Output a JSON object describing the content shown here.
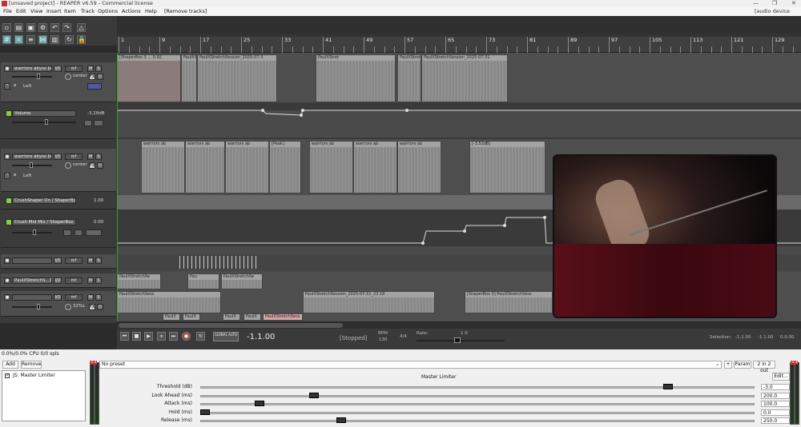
{
  "window": {
    "title": "[unsaved project] - REAPER v6.59 - Commercial license",
    "controls": [
      "—",
      "❐",
      "✕"
    ]
  },
  "menu": {
    "items": [
      "File",
      "Edit",
      "View",
      "Insert",
      "Item",
      "Track",
      "Options",
      "Actions",
      "Help",
      "[Remove tracks]"
    ],
    "right_status": "[audio device closed]"
  },
  "ruler": {
    "bars": [
      "1",
      "9",
      "17",
      "25",
      "33",
      "41",
      "49",
      "57",
      "65",
      "73",
      "81",
      "89",
      "97",
      "105",
      "113",
      "121",
      "129"
    ]
  },
  "tracks": {
    "t1": {
      "name": "warriors abyss be",
      "pan": "center",
      "fx": "FX",
      "label": "Left",
      "mute": "M",
      "solo": "S",
      "io": "I/O",
      "rec": "mf"
    },
    "t1env": {
      "name": "Volume",
      "value": "-3.28dB"
    },
    "t2": {
      "name": "warriors abyss be",
      "pan": "center",
      "fx": "FX",
      "label": "Left",
      "mute": "M",
      "solo": "S",
      "io": "I/O",
      "rec": "mf"
    },
    "t2env1": {
      "name": "CrushShaper On / ShaperBox 3",
      "value": "1.00"
    },
    "t2env2": {
      "name": "Crush Mid Mix / ShaperBox 3",
      "value": "0.00"
    },
    "t3": {
      "name": "",
      "io": "I/O",
      "rec": "mf",
      "mute": "M",
      "solo": "S"
    },
    "t4": {
      "name": "PaulXStretchS...14",
      "io": "I/O",
      "rec": "mf",
      "mute": "M",
      "solo": "S"
    },
    "t5": {
      "name": "",
      "pan": "32%L",
      "io": "I/O",
      "rec": "mf",
      "mute": "M",
      "solo": "S"
    }
  },
  "items": {
    "r1": [
      "[ShaperBox 3 ... 0.92",
      "PaulXSt",
      "PaulXStretchSession_2025-07-3",
      "PaulXStret",
      "PaulXStret",
      "PaulXStretchSession_2025-07-31"
    ],
    "r2": [
      "warriors ab",
      "warriors ab",
      "warriors ab",
      "[Peak]",
      "warriors ab",
      "warriors ab",
      "warriors ab",
      "[-3.52dB]"
    ],
    "r3": [
      "PaulXStretchSe",
      "Pau",
      "PaulXStretchSe"
    ],
    "r4": [
      "[ShaperBox 3]",
      "PaulXStretchSess",
      "PaulXStretchSession_2025-07-31_23.18",
      "PaulXS",
      "[ShaperBox 3] PaulXStretchSess"
    ],
    "r5": [
      "PaulX",
      "PaulX",
      "PaulX",
      "PaulX",
      "PaulXStretchSess"
    ]
  },
  "transport": {
    "time": "-1.1.00",
    "status": "[Stopped]",
    "bpm_label": "BPM",
    "bpm": "130",
    "sig": "4/4",
    "rate_label": "Rate:",
    "rate": "1.0",
    "global_auto": "GLOBAL AUTO",
    "selection_label": "Selection:",
    "sel_start": "-1.1.00",
    "sel_end": "-1.1.00",
    "sel_len": "0.0.00"
  },
  "fx": {
    "cpu": "0.0%/0.0% CPU 0/0 spls",
    "add": "Add",
    "remove": "Remove",
    "plugin": "JS: Master Limiter",
    "preset": "No preset",
    "plus": "+",
    "param": "Param",
    "io": "2 in 2 out",
    "name": "Master Limiter",
    "edit": "Edit...",
    "params": [
      {
        "label": "Threshold (dB)",
        "value": "-3.0",
        "pos": 0.85
      },
      {
        "label": "Look Ahead (ms)",
        "value": "200.0",
        "pos": 0.2
      },
      {
        "label": "Attack (ms)",
        "value": "100.0",
        "pos": 0.1
      },
      {
        "label": "Hold (ms)",
        "value": "0.0",
        "pos": 0.0
      },
      {
        "label": "Release (ms)",
        "value": "250.0",
        "pos": 0.25
      }
    ],
    "meter_left": "-5.4",
    "meter_right": "-5.4"
  },
  "colors": {
    "accent": "#7fd33a",
    "record": "#c84"
  }
}
